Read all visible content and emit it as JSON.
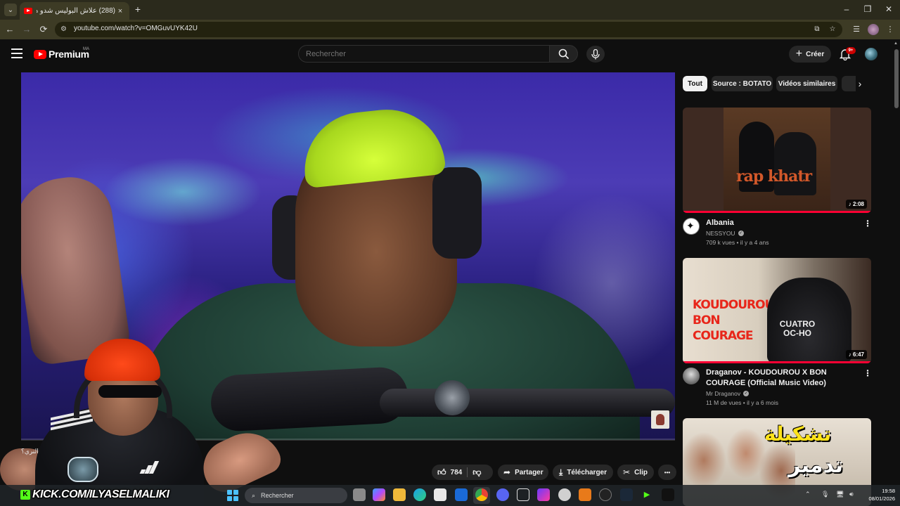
{
  "browser": {
    "tab_title": "(288) علاش البوليس شدو هاد الـ...",
    "tab_close": "×",
    "new_tab": "+",
    "url": "youtube.com/watch?v=OMGuvUYK42U",
    "window_controls": {
      "minimize": "–",
      "maximize": "❐",
      "close": "✕"
    }
  },
  "header": {
    "logo_text": "Premium",
    "logo_country": "MA",
    "search_placeholder": "Rechercher",
    "create_label": "Créer",
    "notifications_badge": "9+"
  },
  "video": {
    "chat_overlay_text": "النري؟",
    "kick_logo": "K",
    "kick_banner": "KICK.COM/ILYASELMALIKI",
    "progress_fraction": 0.0
  },
  "actions": {
    "like_count": "784",
    "share_label": "Partager",
    "download_label": "Télécharger",
    "clip_label": "Clip",
    "more_label": "•••"
  },
  "sidebar": {
    "chips": [
      "Tout",
      "Source : BOTATO",
      "Vidéos similaires"
    ],
    "videos": [
      {
        "thumb_text": "rap khatr",
        "duration": "♪ 2:08",
        "title": "Albania",
        "channel": "NESSYOU",
        "meta": "709 k vues • il y a 4 ans"
      },
      {
        "thumb_text_red": "KOUDOUROU BON COURAGE",
        "thumb_text_shirt": "CUATRO OC-HO",
        "duration": "♪ 6:47",
        "title": "Draganov - KOUDOUROU X BON COURAGE (Official Music Video)",
        "channel": "Mr Draganov",
        "meta": "11 M de vues • il y a 6 mois"
      },
      {
        "thumb_text_1": "تشكيلة",
        "thumb_text_2": "تدمير"
      }
    ]
  },
  "taskbar": {
    "search_label": "Rechercher",
    "time": "19:58",
    "date": "08/01/2026"
  }
}
